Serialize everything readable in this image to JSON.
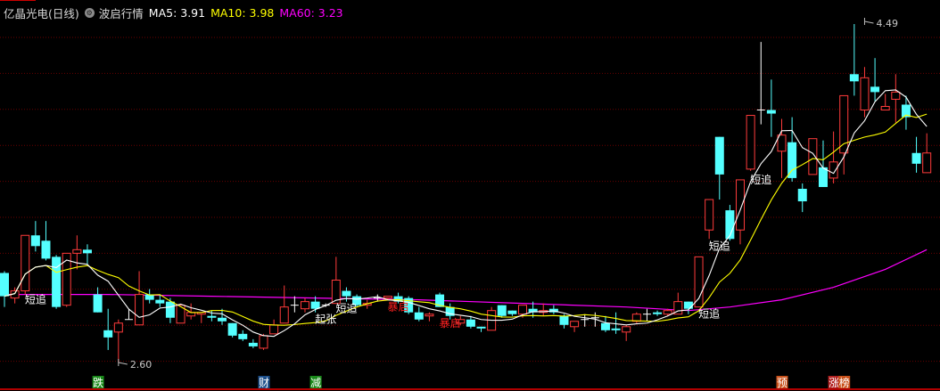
{
  "header": {
    "title": "亿晶光电(日线)",
    "indicator_name": "波启行情",
    "ma5_label": "MA5: 3.91",
    "ma10_label": "MA10: 3.98",
    "ma60_label": "MA60: 3.23",
    "icon": "gear-icon"
  },
  "colors": {
    "up": "#ff3b3b",
    "down": "#54ffff",
    "ma5": "#ffffff",
    "ma10": "#ffff00",
    "ma60": "#ff00ff",
    "grid": "#6a0000"
  },
  "chart_data": {
    "type": "candlestick",
    "title": "亿晶光电(日线)",
    "ylim": [
      2.6,
      4.49
    ],
    "grid": true,
    "annotations": [
      {
        "text": "4.49",
        "index": 83,
        "price": 4.49,
        "kind": "high"
      },
      {
        "text": "2.60",
        "index": 11,
        "price": 2.6,
        "kind": "low"
      }
    ],
    "candles": [
      [
        3.1,
        3.11,
        2.91,
        2.97
      ],
      [
        2.96,
        3.02,
        2.93,
        3.0
      ],
      [
        3.0,
        3.31,
        2.98,
        3.31
      ],
      [
        3.31,
        3.39,
        3.22,
        3.25
      ],
      [
        3.28,
        3.39,
        3.17,
        3.18
      ],
      [
        3.19,
        3.2,
        2.9,
        2.91
      ],
      [
        2.92,
        3.21,
        2.91,
        3.21
      ],
      [
        3.21,
        3.31,
        3.12,
        3.23
      ],
      [
        3.23,
        3.26,
        3.15,
        3.21
      ],
      [
        2.98,
        3.02,
        2.88,
        2.88
      ],
      [
        2.78,
        2.9,
        2.67,
        2.74
      ],
      [
        2.77,
        2.84,
        2.6,
        2.82
      ],
      [
        2.84,
        2.9,
        2.84,
        2.84
      ],
      [
        2.81,
        3.11,
        2.81,
        2.98
      ],
      [
        2.98,
        3.01,
        2.93,
        2.95
      ],
      [
        2.95,
        2.98,
        2.91,
        2.93
      ],
      [
        2.94,
        2.96,
        2.82,
        2.85
      ],
      [
        2.82,
        2.92,
        2.82,
        2.92
      ],
      [
        2.86,
        2.93,
        2.84,
        2.88
      ],
      [
        2.87,
        2.88,
        2.82,
        2.88
      ],
      [
        2.86,
        2.89,
        2.83,
        2.85
      ],
      [
        2.85,
        2.9,
        2.81,
        2.83
      ],
      [
        2.82,
        2.82,
        2.74,
        2.75
      ],
      [
        2.76,
        2.78,
        2.72,
        2.73
      ],
      [
        2.71,
        2.73,
        2.68,
        2.69
      ],
      [
        2.68,
        2.76,
        2.67,
        2.75
      ],
      [
        2.76,
        2.84,
        2.76,
        2.81
      ],
      [
        2.82,
        3.03,
        2.82,
        2.91
      ],
      [
        2.92,
        2.97,
        2.88,
        2.92
      ],
      [
        2.9,
        2.96,
        2.88,
        2.94
      ],
      [
        2.94,
        2.97,
        2.88,
        2.9
      ],
      [
        2.92,
        2.93,
        2.91,
        2.92
      ],
      [
        2.93,
        3.19,
        2.93,
        3.06
      ],
      [
        3.0,
        3.02,
        2.94,
        2.97
      ],
      [
        2.97,
        2.98,
        2.91,
        2.92
      ],
      [
        2.92,
        2.95,
        2.9,
        2.93
      ],
      [
        2.96,
        2.98,
        2.94,
        2.96
      ],
      [
        2.96,
        2.97,
        2.95,
        2.97
      ],
      [
        2.97,
        2.99,
        2.93,
        2.94
      ],
      [
        2.96,
        2.97,
        2.87,
        2.88
      ],
      [
        2.88,
        2.91,
        2.83,
        2.84
      ],
      [
        2.86,
        2.88,
        2.83,
        2.87
      ],
      [
        2.98,
        2.99,
        2.91,
        2.91
      ],
      [
        2.91,
        2.93,
        2.84,
        2.86
      ],
      [
        2.82,
        2.86,
        2.81,
        2.84
      ],
      [
        2.84,
        2.86,
        2.79,
        2.8
      ],
      [
        2.8,
        2.8,
        2.77,
        2.79
      ],
      [
        2.78,
        2.91,
        2.78,
        2.89
      ],
      [
        2.92,
        2.92,
        2.85,
        2.86
      ],
      [
        2.89,
        2.89,
        2.86,
        2.87
      ],
      [
        2.87,
        2.92,
        2.85,
        2.92
      ],
      [
        2.9,
        2.94,
        2.85,
        2.88
      ],
      [
        2.88,
        2.93,
        2.86,
        2.89
      ],
      [
        2.9,
        2.92,
        2.87,
        2.88
      ],
      [
        2.86,
        2.87,
        2.79,
        2.81
      ],
      [
        2.8,
        2.83,
        2.77,
        2.83
      ],
      [
        2.84,
        2.87,
        2.8,
        2.84
      ],
      [
        2.85,
        2.88,
        2.8,
        2.85
      ],
      [
        2.82,
        2.86,
        2.77,
        2.78
      ],
      [
        2.79,
        2.88,
        2.76,
        2.78
      ],
      [
        2.77,
        2.81,
        2.72,
        2.8
      ],
      [
        2.83,
        2.88,
        2.82,
        2.87
      ],
      [
        2.87,
        2.9,
        2.83,
        2.87
      ],
      [
        2.88,
        2.89,
        2.86,
        2.87
      ],
      [
        2.87,
        2.9,
        2.86,
        2.89
      ],
      [
        2.87,
        2.99,
        2.87,
        2.94
      ],
      [
        2.94,
        2.94,
        2.87,
        2.9
      ],
      [
        2.91,
        3.19,
        2.91,
        3.19
      ],
      [
        3.34,
        3.51,
        3.29,
        3.51
      ],
      [
        3.86,
        3.86,
        3.51,
        3.65
      ],
      [
        3.45,
        3.48,
        3.28,
        3.29
      ],
      [
        3.34,
        3.62,
        3.26,
        3.62
      ],
      [
        3.68,
        3.98,
        3.67,
        3.98
      ],
      [
        4.01,
        4.39,
        3.93,
        4.01
      ],
      [
        4.01,
        4.18,
        3.86,
        3.99
      ],
      [
        3.78,
        3.96,
        3.63,
        3.87
      ],
      [
        3.83,
        3.97,
        3.61,
        3.63
      ],
      [
        3.57,
        3.6,
        3.44,
        3.5
      ],
      [
        3.65,
        3.85,
        3.65,
        3.85
      ],
      [
        3.69,
        3.84,
        3.58,
        3.58
      ],
      [
        3.63,
        3.89,
        3.6,
        3.72
      ],
      [
        3.77,
        4.09,
        3.65,
        4.09
      ],
      [
        4.21,
        4.49,
        4.09,
        4.17
      ],
      [
        4.01,
        4.25,
        3.97,
        4.19
      ],
      [
        4.14,
        4.3,
        4.06,
        4.11
      ],
      [
        4.01,
        4.1,
        4.01,
        4.03
      ],
      [
        4.07,
        4.21,
        3.94,
        4.11
      ],
      [
        4.04,
        4.09,
        3.9,
        3.97
      ],
      [
        3.77,
        3.86,
        3.66,
        3.71
      ],
      [
        3.66,
        3.88,
        3.66,
        3.77
      ]
    ],
    "candle_fields": [
      "open",
      "high",
      "low",
      "close"
    ],
    "ma60_keypoints": [
      [
        0,
        2.98
      ],
      [
        10,
        2.98
      ],
      [
        20,
        2.97
      ],
      [
        30,
        2.96
      ],
      [
        40,
        2.95
      ],
      [
        50,
        2.93
      ],
      [
        60,
        2.91
      ],
      [
        66,
        2.89
      ],
      [
        70,
        2.91
      ],
      [
        75,
        2.95
      ],
      [
        80,
        3.02
      ],
      [
        85,
        3.12
      ],
      [
        89,
        3.23
      ]
    ],
    "signals": [
      {
        "text": "短追",
        "index": 3,
        "price": 2.96,
        "color": "#ffffff"
      },
      {
        "text": "起张",
        "index": 31,
        "price": 2.85,
        "color": "#ffffff"
      },
      {
        "text": "短追",
        "index": 33,
        "price": 2.91,
        "color": "#ffffff"
      },
      {
        "text": "暴启",
        "index": 38,
        "price": 2.92,
        "color": "#ff2020"
      },
      {
        "text": "暴启",
        "index": 43,
        "price": 2.83,
        "color": "#ff2020"
      },
      {
        "text": "短追",
        "index": 68,
        "price": 2.88,
        "color": "#ffffff"
      },
      {
        "text": "短追",
        "index": 69,
        "price": 3.26,
        "color": "#ffffff"
      },
      {
        "text": "短追",
        "index": 73,
        "price": 3.63,
        "color": "#ffffff"
      }
    ],
    "event_badges": [
      {
        "text": "跌",
        "index": 9,
        "color": "#1a8a1a"
      },
      {
        "text": "财",
        "index": 25,
        "color": "#1d4f8a"
      },
      {
        "text": "减",
        "index": 30,
        "color": "#1a8a1a"
      },
      {
        "text": "预",
        "index": 75,
        "color": "#c8501a"
      },
      {
        "text": "涨",
        "index": 80,
        "color": "#b02020"
      },
      {
        "text": "榜",
        "index": 81,
        "color": "#c8501a"
      }
    ]
  }
}
